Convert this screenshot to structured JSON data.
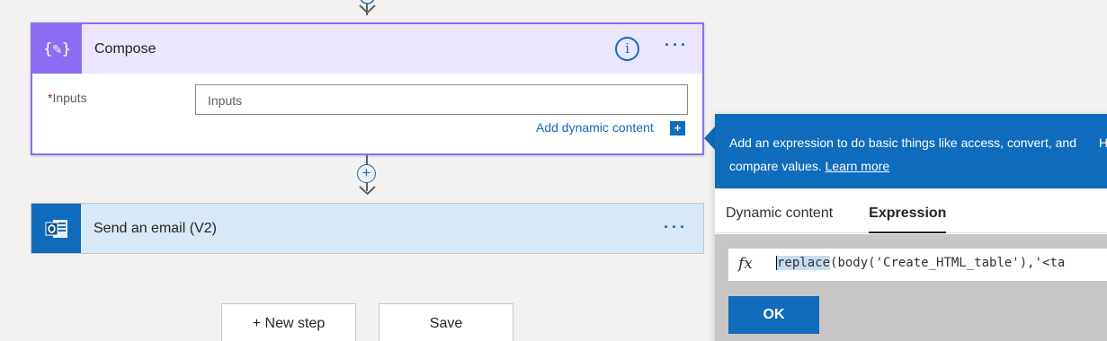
{
  "compose": {
    "title": "Compose",
    "icon_glyph": "{✎}",
    "inputs_label": "Inputs",
    "required_mark": "*",
    "inputs_placeholder": "Inputs",
    "add_dynamic_label": "Add dynamic content",
    "add_dynamic_glyph": "+",
    "info_glyph": "i",
    "menu_glyph": "···"
  },
  "connector": {
    "add_glyph": "+"
  },
  "send_email": {
    "title": "Send an email (V2)",
    "menu_glyph": "···"
  },
  "footer": {
    "new_step_label": "+ New step",
    "save_label": "Save"
  },
  "expression_panel": {
    "description": "Add an expression to do basic things like access, convert, and compare values.",
    "learn_more": "Learn more",
    "clipped_text": "H",
    "tabs": [
      "Dynamic content",
      "Expression"
    ],
    "active_tab": "Expression",
    "fx_glyph": "fx",
    "expression_highlight": "replace",
    "expression_rest": "(body('Create_HTML_table'),'<ta",
    "ok_label": "OK"
  },
  "colors": {
    "compose_accent": "#8c6cf2",
    "compose_header_bg": "#ebe5fd",
    "link_blue": "#0f6cbd",
    "email_header_bg": "#d9e8f6",
    "canvas_bg": "#f3f2f1"
  }
}
